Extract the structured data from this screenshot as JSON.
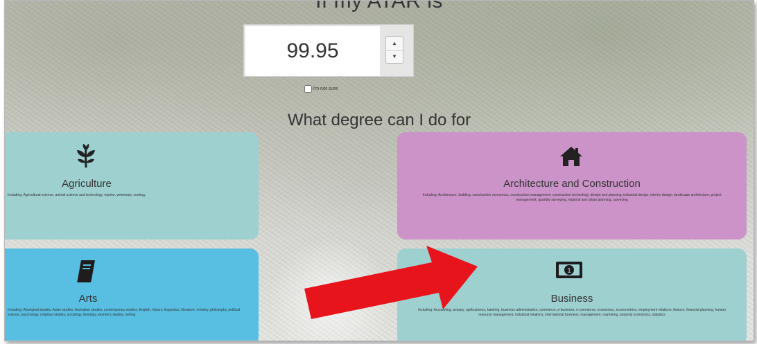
{
  "atar": {
    "heading": "If my ATAR is",
    "value": "99.95",
    "not_sure_label": "I'm not sure"
  },
  "degree_heading": "What degree can I do for",
  "cards": [
    {
      "id": "agriculture",
      "icon": "sprout-icon",
      "title": "Agriculture",
      "description": "Including: Agricultural science, animal science and technology, equine, veterinary, zoology"
    },
    {
      "id": "architecture",
      "icon": "home-icon",
      "title": "Architecture and Construction",
      "description": "Including: Architecture, building, construction economics, construction management, construction technology, design and planning, industrial design, interior design, landscape architecture, project management, quantity surveying, regional and urban planning, surveying"
    },
    {
      "id": "arts",
      "icon": "book-icon",
      "title": "Arts",
      "description": "Including: Aboriginal studies, Asian studies, Australian studies, contemporary studies, English, history, linguistics, literature, ministry, philosophy, political science, psychology, religious studies, sociology, theology, women's studies, writing"
    },
    {
      "id": "business",
      "icon": "money-icon",
      "title": "Business",
      "description": "Including: Accounting, actuary, agribusiness, banking, business administration, commerce, e-business, e-commerce, economics, econometrics, employment relations, finance, financial planning, human resource management, industrial relations, international business, management, marketing, property economics, statistics"
    }
  ],
  "colors": {
    "agriculture": "#9ed0d0",
    "architecture": "#cc93c8",
    "arts": "#58bfe2",
    "business": "#9ed0d0",
    "arrow": "#e8141c"
  }
}
